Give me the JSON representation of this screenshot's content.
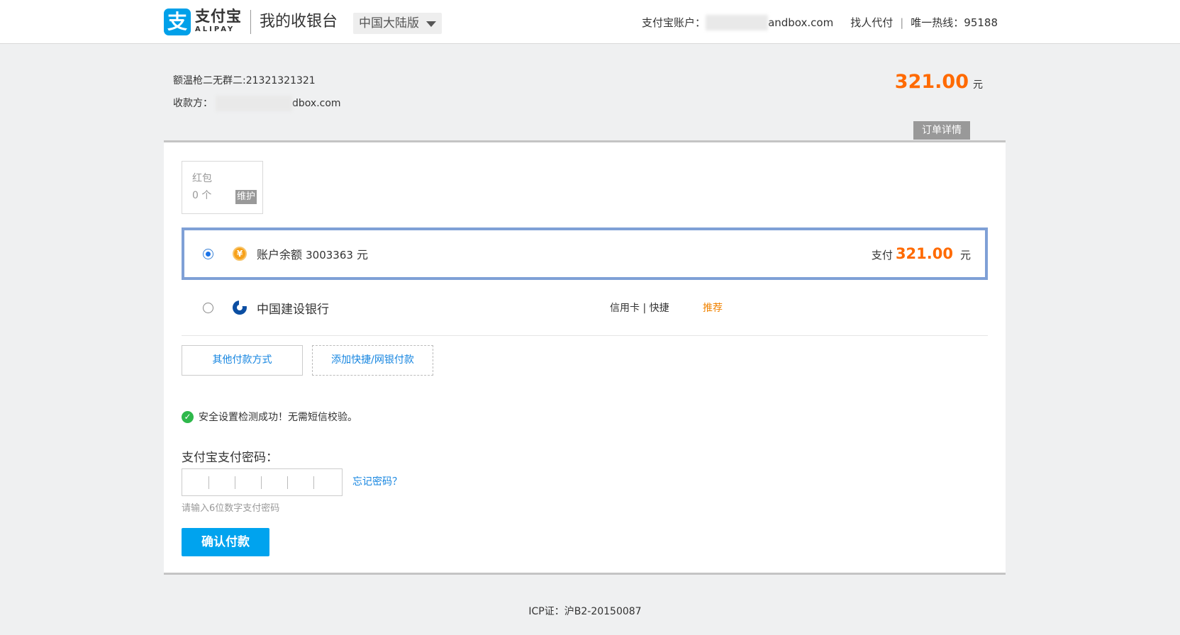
{
  "header": {
    "logo_glyph": "支",
    "logo_cn": "支付宝",
    "logo_en": "ALIPAY",
    "title": "我的收银台",
    "region": "中国大陆版",
    "account_label": "支付宝账户：",
    "account_value_visible": "andbox.com",
    "find_pay": "找人代付",
    "separator": "|",
    "hotline": "唯一热线：95188"
  },
  "order": {
    "name": "额温枪二无群二:21321321321",
    "payee_label": "收款方：",
    "payee_value_visible": "dbox.com",
    "amount": "321.00",
    "unit": "元",
    "detail_button": "订单详情"
  },
  "redpack": {
    "title": "红包",
    "count": "0 个",
    "tag": "维护"
  },
  "methods": {
    "balance": {
      "icon_glyph": "¥",
      "label": "账户余额",
      "value": "3003363",
      "unit": "元",
      "pay_label": "支付",
      "pay_amount": "321.00",
      "pay_unit": "元",
      "selected": true
    },
    "bank": {
      "label": "中国建设银行",
      "cards": "信用卡 | 快捷",
      "recommend": "推荐",
      "selected": false
    }
  },
  "buttons": {
    "other_methods": "其他付款方式",
    "add_card": "添加快捷/网银付款",
    "confirm": "确认付款"
  },
  "security": {
    "check_glyph": "✓",
    "message": "安全设置检测成功！无需短信校验。"
  },
  "password": {
    "label": "支付宝支付密码：",
    "forgot": "忘记密码？",
    "hint": "请输入6位数字支付密码"
  },
  "footer": {
    "icp": "ICP证：沪B2-20150087"
  },
  "colors": {
    "brand_blue": "#00a0e9",
    "amount_orange": "#ff6a00",
    "link_blue": "#1585e0",
    "success_green": "#2eb84b",
    "selected_border": "#7fa0d6"
  },
  "icons": [
    "alipay-logo-icon",
    "chevron-down-icon",
    "balance-yuan-icon",
    "ccb-bank-icon",
    "check-circle-icon"
  ]
}
